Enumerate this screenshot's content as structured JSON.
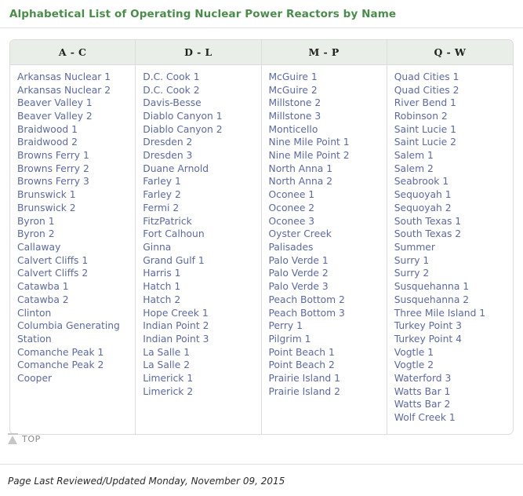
{
  "page": {
    "title": "Alphabetical List of Operating Nuclear Power Reactors by Name"
  },
  "colors": {
    "title_green": "#4b8b4b",
    "link_blue": "#5d6a9c",
    "header_bg": "#e9efe8",
    "border_gray": "#dcdcdc",
    "top_icon_gray": "#c6c6c6"
  },
  "table": {
    "columns": [
      {
        "header": "A - C",
        "items": [
          "Arkansas Nuclear 1",
          "Arkansas Nuclear 2",
          "Beaver Valley 1",
          "Beaver Valley 2",
          "Braidwood 1",
          "Braidwood 2",
          "Browns Ferry 1",
          "Browns Ferry 2",
          "Browns Ferry 3",
          "Brunswick 1",
          "Brunswick 2",
          "Byron 1",
          "Byron 2",
          "Callaway",
          "Calvert Cliffs 1",
          "Calvert Cliffs 2",
          "Catawba 1",
          "Catawba 2",
          "Clinton",
          "Columbia Generating Station",
          "Comanche Peak 1",
          "Comanche Peak 2",
          "Cooper"
        ]
      },
      {
        "header": "D - L",
        "items": [
          "D.C. Cook 1",
          "D.C. Cook 2",
          "Davis-Besse",
          "Diablo Canyon 1",
          "Diablo Canyon 2",
          "Dresden 2",
          "Dresden 3",
          "Duane Arnold",
          "Farley 1",
          "Farley 2",
          "Fermi 2",
          "FitzPatrick",
          "Fort Calhoun",
          "Ginna",
          "Grand Gulf 1",
          "Harris 1",
          "Hatch 1",
          "Hatch 2",
          "Hope Creek 1",
          "Indian Point 2",
          "Indian Point 3",
          "La Salle 1",
          "La Salle 2",
          "Limerick 1",
          "Limerick 2"
        ]
      },
      {
        "header": "M - P",
        "items": [
          "McGuire 1",
          "McGuire 2",
          "Millstone 2",
          "Millstone 3",
          "Monticello",
          "Nine Mile Point 1",
          "Nine Mile Point 2",
          "North Anna 1",
          "North Anna 2",
          "Oconee 1",
          "Oconee 2",
          "Oconee 3",
          "Oyster Creek",
          "Palisades",
          "Palo Verde 1",
          "Palo Verde 2",
          "Palo Verde 3",
          "Peach Bottom 2",
          "Peach Bottom 3",
          "Perry 1",
          "Pilgrim 1",
          "Point Beach 1",
          "Point Beach 2",
          "Prairie Island 1",
          "Prairie Island 2"
        ]
      },
      {
        "header": "Q - W",
        "items": [
          "Quad Cities 1",
          "Quad Cities 2",
          "River Bend 1",
          "Robinson 2",
          "Saint Lucie 1",
          "Saint Lucie 2",
          "Salem 1",
          "Salem 2",
          "Seabrook 1",
          "Sequoyah 1",
          "Sequoyah 2",
          "South Texas 1",
          "South Texas 2",
          "Summer",
          "Surry 1",
          "Surry 2",
          "Susquehanna 1",
          "Susquehanna 2",
          "Three Mile Island 1",
          "Turkey Point 3",
          "Turkey Point 4",
          "Vogtle 1",
          "Vogtle 2",
          "Waterford 3",
          "Watts Bar 1",
          "Watts Bar 2",
          "Wolf Creek 1"
        ]
      }
    ]
  },
  "back_to_top": {
    "label": "TOP",
    "icon": "arrow-up-to-bar-icon"
  },
  "footer": {
    "last_reviewed": "Page Last Reviewed/Updated Monday, November 09, 2015"
  }
}
